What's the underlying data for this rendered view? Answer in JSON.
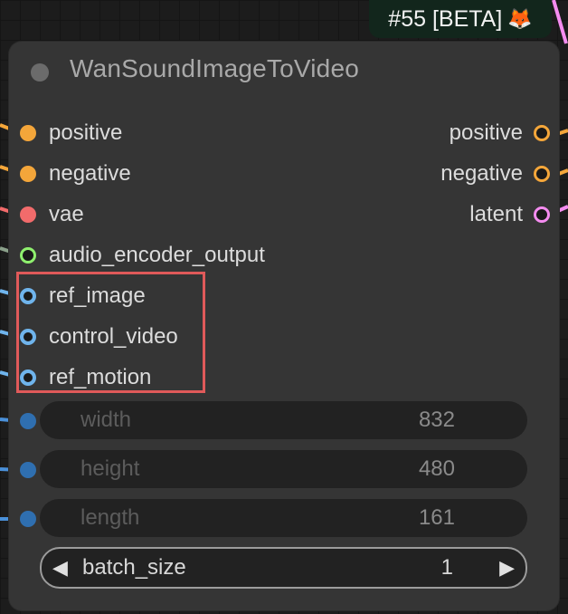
{
  "badge": {
    "text": "#55 [BETA]",
    "emoji": "🦊"
  },
  "node": {
    "title": "WanSoundImageToVideo",
    "inputs": [
      {
        "label": "positive",
        "color": "#f4a63a"
      },
      {
        "label": "negative",
        "color": "#f4a63a"
      },
      {
        "label": "vae",
        "color": "#f26b6b"
      },
      {
        "label": "audio_encoder_output",
        "color": "#8ff06e"
      },
      {
        "label": "ref_image",
        "color": "#6fb4ec"
      },
      {
        "label": "control_video",
        "color": "#6fb4ec"
      },
      {
        "label": "ref_motion",
        "color": "#6fb4ec"
      }
    ],
    "outputs": [
      {
        "label": "positive",
        "color": "#f4a63a"
      },
      {
        "label": "negative",
        "color": "#f4a63a"
      },
      {
        "label": "latent",
        "color": "#f58cf0"
      }
    ],
    "widgets": [
      {
        "label": "width",
        "value": "832"
      },
      {
        "label": "height",
        "value": "480"
      },
      {
        "label": "length",
        "value": "161"
      }
    ],
    "batch_size": {
      "label": "batch_size",
      "value": "1"
    }
  },
  "icons": {
    "title_dot": "collapse-dot-icon",
    "left_arrow": "◀",
    "right_arrow": "▶"
  },
  "highlight_color": "#e05a5a"
}
